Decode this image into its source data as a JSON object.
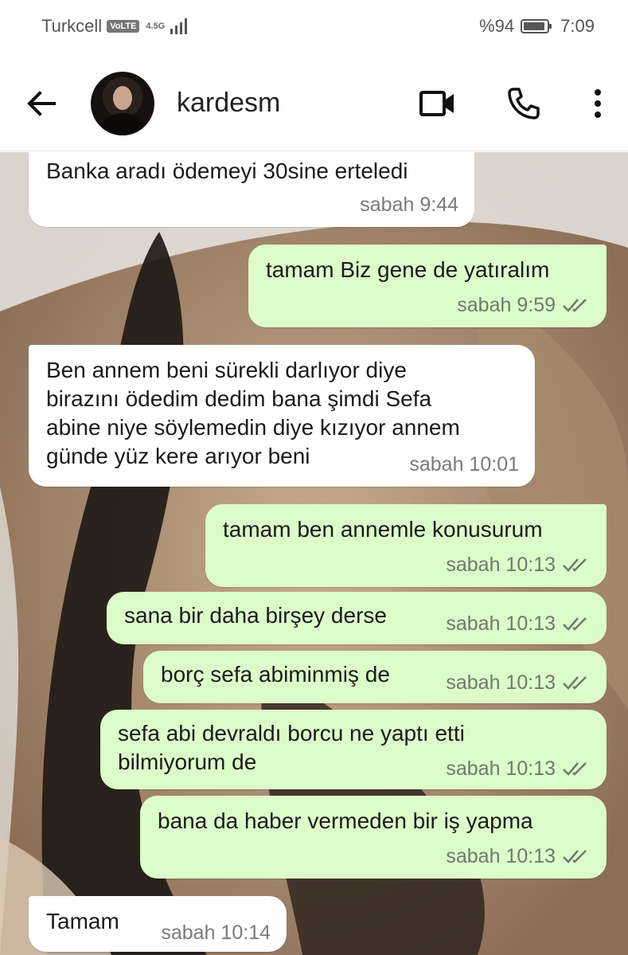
{
  "status_bar": {
    "carrier": "Turkcell",
    "volte": "VoLTE",
    "network": "4.5G",
    "battery_text": "%94",
    "battery_level": 0.94,
    "time": "7:09"
  },
  "header": {
    "contact_name": "kardesm"
  },
  "messages": [
    {
      "dir": "in",
      "text": "Banka aradı ödemeyi 30sine erteledi",
      "time": "sabah 9:44"
    },
    {
      "dir": "out",
      "text": "tamam Biz gene de yatıralım",
      "time": "sabah 9:59"
    },
    {
      "dir": "in",
      "text": "Ben annem beni sürekli darlıyor diye\nbirazını ödedim dedim bana şimdi Sefa\nabine niye söylemedin diye kızıyor annem\ngünde yüz kere arıyor beni",
      "time": "sabah 10:01"
    },
    {
      "dir": "out",
      "text": "tamam ben annemle konusurum",
      "time": "sabah 10:13"
    },
    {
      "dir": "out",
      "text": "sana bir daha birşey derse",
      "time": "sabah 10:13"
    },
    {
      "dir": "out",
      "text": "borç sefa abiminmiş de",
      "time": "sabah 10:13"
    },
    {
      "dir": "out",
      "text": "sefa abi devraldı borcu ne yaptı etti\nbilmiyorum de",
      "time": "sabah 10:13"
    },
    {
      "dir": "out",
      "text": "bana da haber vermeden bir iş yapma",
      "time": "sabah 10:13"
    },
    {
      "dir": "in",
      "text": "Tamam",
      "time": "sabah 10:14"
    }
  ],
  "colors": {
    "incoming_bubble": "#ffffff",
    "outgoing_bubble": "#dcfcc9",
    "timestamp": "#6f7a6e"
  }
}
